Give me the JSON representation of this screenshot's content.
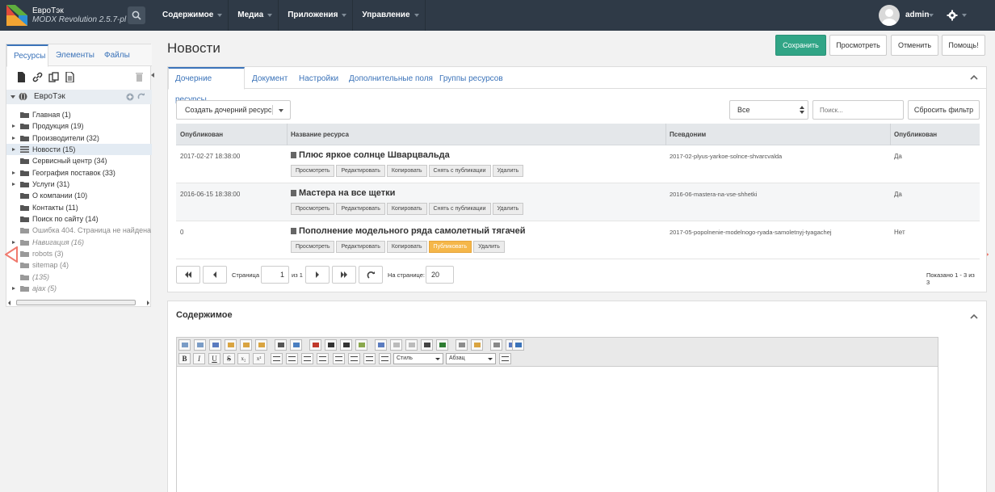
{
  "brand": {
    "name": "ЕвроТэк",
    "version": "MODX Revolution 2.5.7-pl"
  },
  "topnav": [
    {
      "label": "Содержимое"
    },
    {
      "label": "Медиа"
    },
    {
      "label": "Приложения"
    },
    {
      "label": "Управление"
    }
  ],
  "user": {
    "name": "admin"
  },
  "left_tabs": [
    {
      "label": "Ресурсы"
    },
    {
      "label": "Элементы"
    },
    {
      "label": "Файлы"
    }
  ],
  "tree": {
    "root": "ЕвроТэк",
    "items": [
      {
        "label": "Главная (1)"
      },
      {
        "label": "Продукция (19)"
      },
      {
        "label": "Производители (32)"
      },
      {
        "label": "Новости (15)"
      },
      {
        "label": "Сервисный центр (34)"
      },
      {
        "label": "География поставок (33)"
      },
      {
        "label": "Услуги (31)"
      },
      {
        "label": "О компании (10)"
      },
      {
        "label": "Контакты (11)"
      },
      {
        "label": "Поиск по сайту (14)"
      },
      {
        "label": "Ошибка 404. Страница не найдена (2"
      },
      {
        "label": "Навигация (16)"
      },
      {
        "label": "robots (3)"
      },
      {
        "label": "sitemap (4)"
      },
      {
        "label": "(135)"
      },
      {
        "label": "ajax (5)"
      }
    ]
  },
  "page": {
    "title": "Новости"
  },
  "actions": {
    "save": "Сохранить",
    "view": "Просмотреть",
    "cancel": "Отменить",
    "help": "Помощь!"
  },
  "main_tabs": [
    {
      "label": "Дочерние ресурсы"
    },
    {
      "label": "Документ"
    },
    {
      "label": "Настройки"
    },
    {
      "label": "Дополнительные поля"
    },
    {
      "label": "Группы ресурсов"
    }
  ],
  "toolbar": {
    "create_child": "Создать дочерний ресурс",
    "filter_value": "Все",
    "search_placeholder": "Поиск...",
    "reset_filter": "Сбросить фильтр"
  },
  "grid": {
    "columns": [
      "Опубликован",
      "Название ресурса",
      "Псевдоним",
      "Опубликован"
    ],
    "rows": [
      {
        "date": "2017-02-27 18:38:00",
        "name": "Плюс яркое солнце Шварцвальда",
        "alias": "2017-02-plyus-yarkoe-solnce-shvarcvalda",
        "published": "Да",
        "buttons": [
          "Просмотреть",
          "Редактировать",
          "Копировать",
          "Снять с публикации",
          "Удалить"
        ]
      },
      {
        "date": "2016-06-15 18:38:00",
        "name": "Мастера на все щетки",
        "alias": "2016-06-mastera-na-vse-shhetki",
        "published": "Да",
        "buttons": [
          "Просмотреть",
          "Редактировать",
          "Копировать",
          "Снять с публикации",
          "Удалить"
        ]
      },
      {
        "date": "0",
        "name": "Пополнение модельного ряда самолетный тягачей",
        "alias": "2017-05-popolnenie-modelnogo-ryada-samoletnyj-tyagachej",
        "published": "Нет",
        "buttons": [
          "Просмотреть",
          "Редактировать",
          "Копировать",
          "Публиковать",
          "Удалить"
        ]
      }
    ]
  },
  "pager": {
    "page_label": "Страница",
    "page_value": "1",
    "of_label": "из 1",
    "per_page_label": "На странице:",
    "per_page_value": "20",
    "shown": "Показано 1 - 3 из 3"
  },
  "content": {
    "title": "Содержимое",
    "style_select": "Стиль",
    "format_select": "Абзац",
    "bold": "B",
    "italic": "I",
    "underline": "U",
    "strike": "S",
    "subscript": "x₂",
    "superscript": "x²"
  },
  "colors": {
    "topbar": "#2f3a47",
    "accent": "#3b73b9",
    "primary_button": "#31a586",
    "warn_button": "#f5b74a",
    "side_arrow": "#f07a6e"
  }
}
